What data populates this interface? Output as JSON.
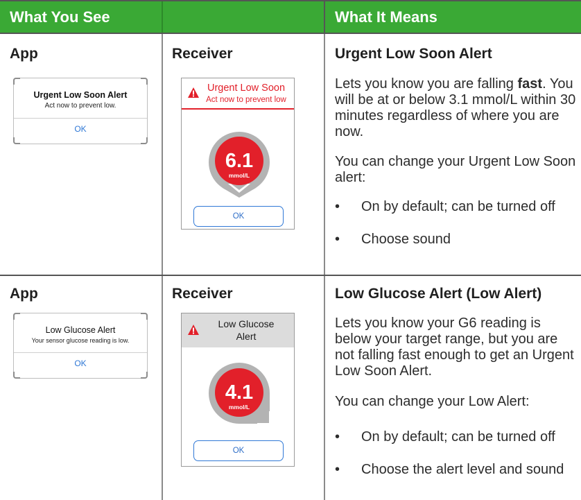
{
  "header": {
    "col1": "What You See",
    "col2": "What It Means"
  },
  "rows": [
    {
      "app_label": "App",
      "receiver_label": "Receiver",
      "app_dialog": {
        "title": "Urgent Low Soon Alert",
        "subtitle": "Act now to prevent low.",
        "ok": "OK"
      },
      "receiver": {
        "title_line1": "Urgent Low Soon",
        "title_line2": "Act now to prevent low",
        "reading": "6.1",
        "unit": "mmol/L",
        "ok": "OK"
      },
      "means_title": "Urgent Low Soon Alert",
      "para1_pre": "Lets you know you are falling ",
      "para1_bold": "fast",
      "para1_post": ". You will be at or below 3.1 mmol/L within 30 minutes regardless of where you are now.",
      "para2": "You can change your Urgent Low Soon alert:",
      "bullets": [
        "On by default; can be turned off",
        "Choose sound"
      ]
    },
    {
      "app_label": "App",
      "receiver_label": "Receiver",
      "app_dialog": {
        "title": "Low Glucose Alert",
        "subtitle": "Your sensor glucose reading is low.",
        "ok": "OK"
      },
      "receiver": {
        "title_line1": "Low Glucose",
        "title_line2": "Alert",
        "reading": "4.1",
        "unit": "mmol/L",
        "ok": "OK"
      },
      "means_title": "Low Glucose Alert (Low Alert)",
      "para1": "Lets you know your G6 reading is below your target range, but you are not falling fast enough to get an Urgent Low Soon Alert.",
      "para2": "You can change your Low Alert:",
      "bullets": [
        "On by default; can be turned off",
        "Choose the alert level and sound"
      ]
    }
  ],
  "bullet_glyph": "•",
  "colors": {
    "header_green": "#3aa935",
    "alert_red": "#e2202a",
    "ok_blue": "#2f78d6",
    "gauge_grey": "#b3b3b3"
  }
}
